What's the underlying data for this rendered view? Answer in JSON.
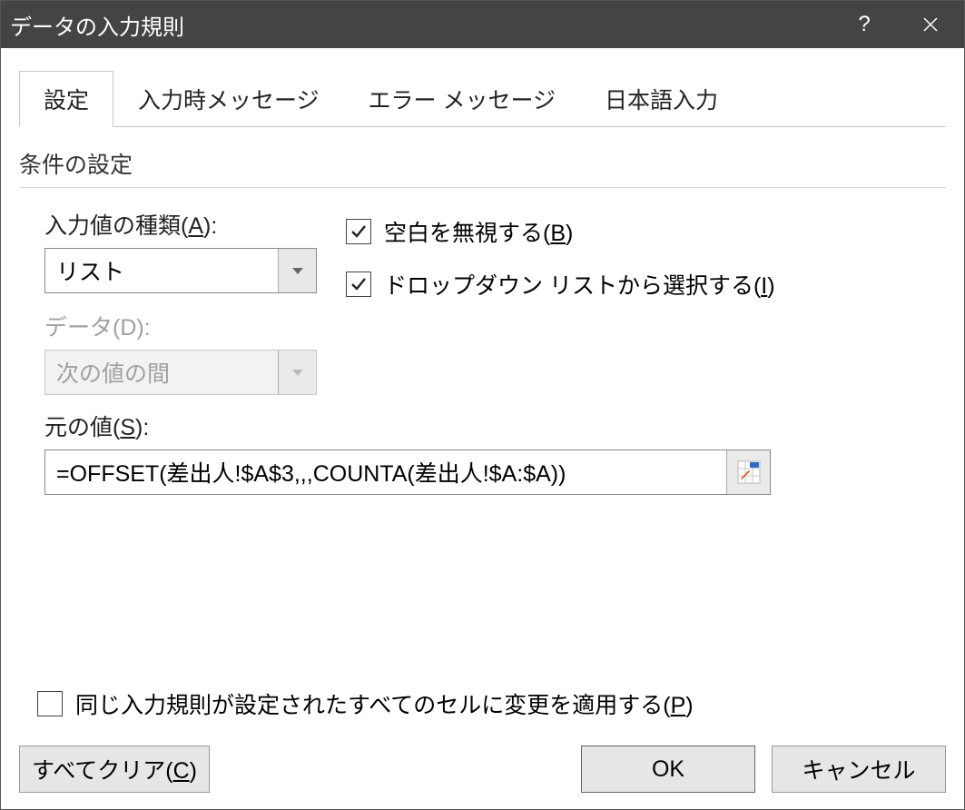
{
  "titlebar": {
    "title": "データの入力規則"
  },
  "tabs": [
    {
      "label": "設定"
    },
    {
      "label": "入力時メッセージ"
    },
    {
      "label": "エラー メッセージ"
    },
    {
      "label": "日本語入力"
    }
  ],
  "section": {
    "title": "条件の設定"
  },
  "fields": {
    "allow_label_pre": "入力値の種類(",
    "allow_key": "A",
    "allow_label_post": "):",
    "allow_value": "リスト",
    "data_label_pre": "データ(",
    "data_key": "D",
    "data_label_post": "):",
    "data_value": "次の値の間",
    "source_label_pre": "元の値(",
    "source_key": "S",
    "source_label_post": "):",
    "source_value": "=OFFSET(差出人!$A$3,,,COUNTA(差出人!$A:$A))"
  },
  "checkboxes": {
    "ignore_blank_pre": "空白を無視する(",
    "ignore_blank_key": "B",
    "ignore_blank_post": ")",
    "dropdown_pre": "ドロップダウン リストから選択する(",
    "dropdown_key": "I",
    "dropdown_post": ")",
    "apply_all_pre": "同じ入力規則が設定されたすべてのセルに変更を適用する(",
    "apply_all_key": "P",
    "apply_all_post": ")"
  },
  "buttons": {
    "clear_pre": "すべてクリア(",
    "clear_key": "C",
    "clear_post": ")",
    "ok": "OK",
    "cancel": "キャンセル"
  }
}
